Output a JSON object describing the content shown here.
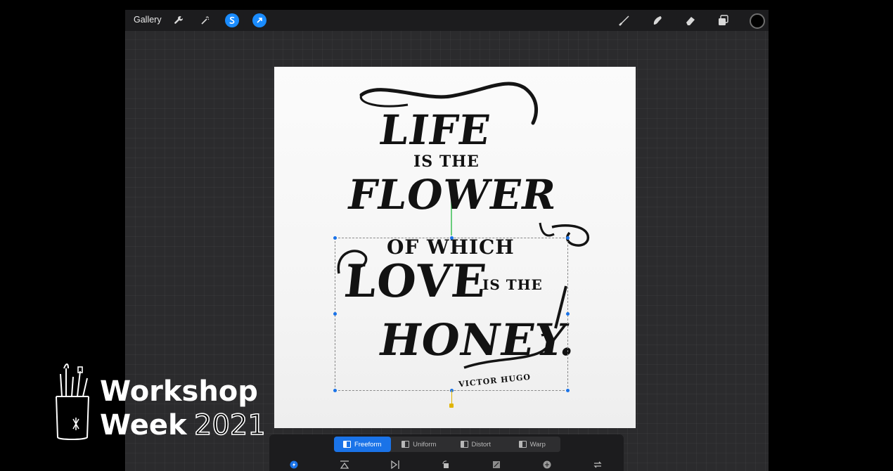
{
  "toolbar": {
    "gallery_label": "Gallery",
    "icons": [
      "wrench-icon",
      "magic-wand-icon",
      "selection-s-icon",
      "transform-arrow-icon",
      "brush-icon",
      "smudge-icon",
      "eraser-icon",
      "layers-icon",
      "color-icon"
    ],
    "accent": "#1a8cff",
    "current_color": "#000000"
  },
  "artwork": {
    "line1": "LIFE",
    "line2": "IS THE",
    "line3": "FLOWER",
    "line4": "OF WHICH",
    "line5a": "LOVE",
    "line5b": "IS THE",
    "line6": "HONEY.",
    "signature": "VICTOR HUGO"
  },
  "transform": {
    "modes": [
      {
        "label": "Freeform",
        "active": true
      },
      {
        "label": "Uniform",
        "active": false
      },
      {
        "label": "Distort",
        "active": false
      },
      {
        "label": "Warp",
        "active": false
      }
    ],
    "tools": [
      "magnetics-icon",
      "flip-horizontal-icon",
      "flip-vertical-icon",
      "rotate-icon",
      "fit-to-screen-icon",
      "interpolation-icon",
      "reset-icon"
    ]
  },
  "overlay": {
    "title": "Workshop",
    "subtitle": "Week",
    "year": "2021"
  }
}
